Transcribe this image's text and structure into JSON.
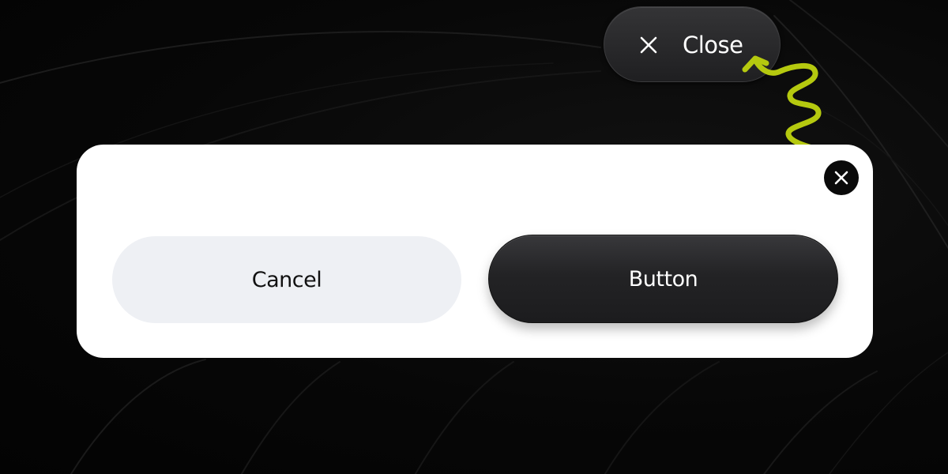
{
  "tooltip": {
    "icon": "close-icon",
    "label": "Close"
  },
  "dialog": {
    "close_icon": "close-icon",
    "cancel_label": "Cancel",
    "primary_label": "Button"
  },
  "colors": {
    "accent_arrow": "#b5c90f",
    "primary_button": "#232325",
    "secondary_button": "#eef0f4",
    "dialog_background": "#ffffff",
    "page_background": "#050505"
  }
}
